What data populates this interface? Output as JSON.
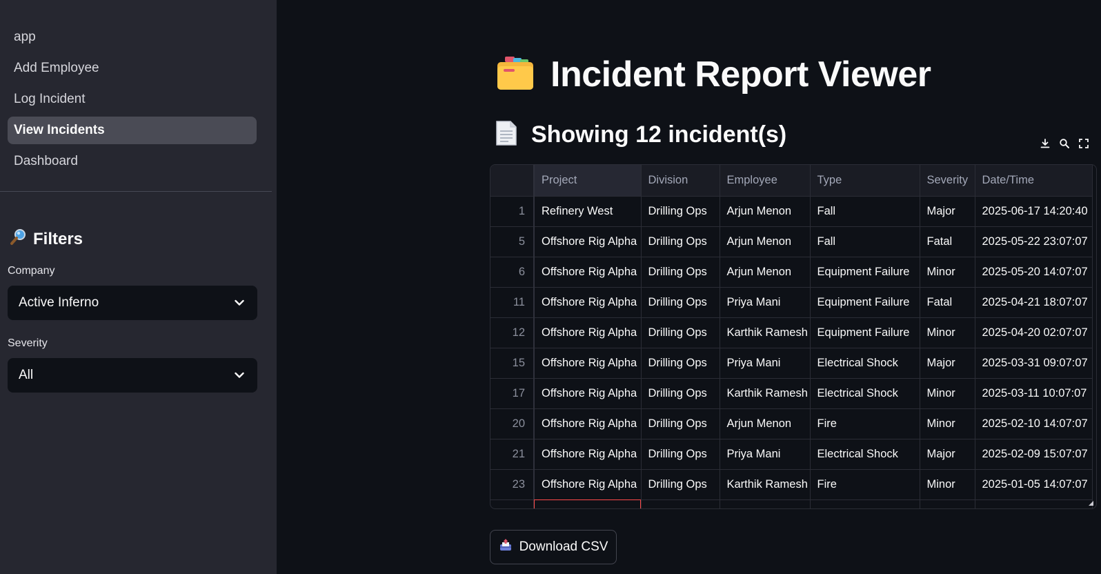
{
  "sidebar": {
    "nav": [
      "app",
      "Add Employee",
      "Log Incident",
      "View Incidents",
      "Dashboard"
    ],
    "active_nav": "View Incidents",
    "filters_title": "Filters",
    "company_label": "Company",
    "company_value": "Active Inferno",
    "severity_label": "Severity",
    "severity_value": "All"
  },
  "main": {
    "title": "Incident Report Viewer",
    "subtitle": "Showing 12 incident(s)",
    "download_label": "Download CSV"
  },
  "table": {
    "columns": [
      "Project",
      "Division",
      "Employee",
      "Type",
      "Severity",
      "Date/Time"
    ],
    "rows": [
      {
        "idx": "1",
        "cells": [
          "Refinery West",
          "Drilling Ops",
          "Arjun Menon",
          "Fall",
          "Major",
          "2025-06-17 14:20:40"
        ]
      },
      {
        "idx": "5",
        "cells": [
          "Offshore Rig Alpha",
          "Drilling Ops",
          "Arjun Menon",
          "Fall",
          "Fatal",
          "2025-05-22 23:07:07"
        ]
      },
      {
        "idx": "6",
        "cells": [
          "Offshore Rig Alpha",
          "Drilling Ops",
          "Arjun Menon",
          "Equipment Failure",
          "Minor",
          "2025-05-20 14:07:07"
        ]
      },
      {
        "idx": "11",
        "cells": [
          "Offshore Rig Alpha",
          "Drilling Ops",
          "Priya Mani",
          "Equipment Failure",
          "Fatal",
          "2025-04-21 18:07:07"
        ]
      },
      {
        "idx": "12",
        "cells": [
          "Offshore Rig Alpha",
          "Drilling Ops",
          "Karthik Ramesh",
          "Equipment Failure",
          "Minor",
          "2025-04-20 02:07:07"
        ]
      },
      {
        "idx": "15",
        "cells": [
          "Offshore Rig Alpha",
          "Drilling Ops",
          "Priya Mani",
          "Electrical Shock",
          "Major",
          "2025-03-31 09:07:07"
        ]
      },
      {
        "idx": "17",
        "cells": [
          "Offshore Rig Alpha",
          "Drilling Ops",
          "Karthik Ramesh",
          "Electrical Shock",
          "Minor",
          "2025-03-11 10:07:07"
        ]
      },
      {
        "idx": "20",
        "cells": [
          "Offshore Rig Alpha",
          "Drilling Ops",
          "Arjun Menon",
          "Fire",
          "Minor",
          "2025-02-10 14:07:07"
        ]
      },
      {
        "idx": "21",
        "cells": [
          "Offshore Rig Alpha",
          "Drilling Ops",
          "Priya Mani",
          "Electrical Shock",
          "Major",
          "2025-02-09 15:07:07"
        ]
      },
      {
        "idx": "23",
        "cells": [
          "Offshore Rig Alpha",
          "Drilling Ops",
          "Karthik Ramesh",
          "Fire",
          "Minor",
          "2025-01-05 14:07:07"
        ]
      }
    ]
  },
  "icons": {
    "title_icon": "card-index-dividers-icon",
    "subtitle_icon": "page-icon",
    "filters_icon": "magnifying-glass-icon",
    "download_icon": "outbox-tray-icon"
  }
}
